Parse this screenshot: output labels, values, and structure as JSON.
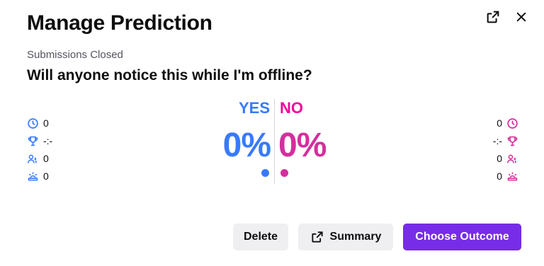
{
  "header": {
    "title": "Manage Prediction",
    "status": "Submissions Closed",
    "question": "Will anyone notice this while I'm offline?"
  },
  "outcomes": {
    "yes": {
      "label": "YES",
      "percent": "0%",
      "color": "#387aff",
      "stats": {
        "points": "0",
        "top_points": "-:-",
        "users": "0",
        "ratio": "0"
      }
    },
    "no": {
      "label": "NO",
      "percent": "0%",
      "color": "#d32f9e",
      "stats": {
        "points": "0",
        "top_points": "-:-",
        "users": "0",
        "ratio": "0"
      }
    }
  },
  "icons": {
    "popout": "popout-icon",
    "close": "close-icon",
    "points": "clock-icon",
    "top_points": "trophy-icon",
    "users": "users-icon",
    "ratio": "ratio-icon"
  },
  "footer": {
    "delete_label": "Delete",
    "summary_label": "Summary",
    "choose_label": "Choose Outcome"
  },
  "colors": {
    "primary": "#772ce8",
    "secondary": "#efeff1"
  }
}
